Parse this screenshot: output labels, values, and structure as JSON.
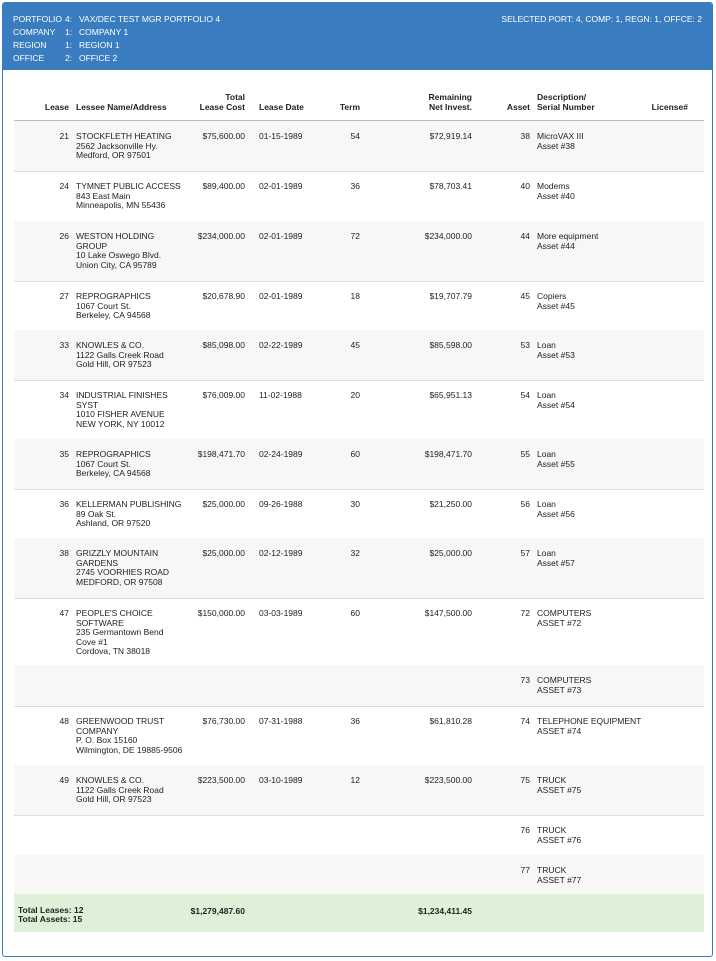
{
  "header": {
    "rows": [
      {
        "key": "PORTFOLIO",
        "num": "4:",
        "value": "VAX/DEC TEST MGR PORTFOLIO 4"
      },
      {
        "key": "COMPANY",
        "num": "1:",
        "value": "COMPANY 1"
      },
      {
        "key": "REGION",
        "num": "1:",
        "value": "REGION 1"
      },
      {
        "key": "OFFICE",
        "num": "2:",
        "value": "OFFICE 2"
      }
    ],
    "selected": "SELECTED PORT: 4, COMP: 1, REGN: 1, OFFCE: 2"
  },
  "columns": {
    "lease": "Lease",
    "name": "Lessee Name/Address",
    "cost_1": "Total",
    "cost_2": "Lease Cost",
    "date": "Lease Date",
    "term": "Term",
    "net_1": "Remaining",
    "net_2": "Net Invest.",
    "asset": "Asset",
    "desc_1": "Description/",
    "desc_2": "Serial Number",
    "license": "License#"
  },
  "rows": [
    {
      "lease": "21",
      "name": [
        "STOCKFLETH HEATING",
        "2562 Jacksonville Hy.",
        "Medford,  OR 97501"
      ],
      "cost": "$75,600.00",
      "date": "01-15-1989",
      "term": "54",
      "net": "$72,919.14",
      "asset": "38",
      "desc": [
        "MicroVAX III",
        "Asset #38"
      ]
    },
    {
      "lease": "24",
      "name": [
        "TYMNET PUBLIC ACCESS",
        "843 East Main",
        "Minneapolis,  MN 55436"
      ],
      "cost": "$89,400.00",
      "date": "02-01-1989",
      "term": "36",
      "net": "$78,703.41",
      "asset": "40",
      "desc": [
        "Modems",
        "Asset #40"
      ]
    },
    {
      "lease": "26",
      "name": [
        "WESTON HOLDING",
        "GROUP",
        "10 Lake Oswego Blvd.",
        "Union City,  CA 95789"
      ],
      "cost": "$234,000.00",
      "date": "02-01-1989",
      "term": "72",
      "net": "$234,000.00",
      "asset": "44",
      "desc": [
        "More equipment",
        "Asset #44"
      ]
    },
    {
      "lease": "27",
      "name": [
        "REPROGRAPHICS",
        "1067 Court St.",
        "Berkeley,  CA 94568"
      ],
      "cost": "$20,678.90",
      "date": "02-01-1989",
      "term": "18",
      "net": "$19,707.79",
      "asset": "45",
      "desc": [
        "Copiers",
        "Asset #45"
      ]
    },
    {
      "lease": "33",
      "name": [
        "KNOWLES & CO.",
        "1122 Galls Creek Road",
        "Gold Hill,  OR 97523"
      ],
      "cost": "$85,098.00",
      "date": "02-22-1989",
      "term": "45",
      "net": "$85,598.00",
      "asset": "53",
      "desc": [
        "Loan",
        "Asset #53"
      ]
    },
    {
      "lease": "34",
      "name": [
        "INDUSTRIAL FINISHES",
        "SYST",
        "1010 FISHER AVENUE",
        "NEW YORK,  NY 10012"
      ],
      "cost": "$76,009.00",
      "date": "11-02-1988",
      "term": "20",
      "net": "$65,951.13",
      "asset": "54",
      "desc": [
        "Loan",
        "Asset #54"
      ]
    },
    {
      "lease": "35",
      "name": [
        "REPROGRAPHICS",
        "1067 Court St.",
        "Berkeley,  CA 94568"
      ],
      "cost": "$198,471.70",
      "date": "02-24-1989",
      "term": "60",
      "net": "$198,471.70",
      "asset": "55",
      "desc": [
        "Loan",
        "Asset #55"
      ]
    },
    {
      "lease": "36",
      "name": [
        "KELLERMAN PUBLISHING",
        "89 Oak St.",
        "Ashland,  OR 97520"
      ],
      "cost": "$25,000.00",
      "date": "09-26-1988",
      "term": "30",
      "net": "$21,250.00",
      "asset": "56",
      "desc": [
        "Loan",
        "Asset #56"
      ]
    },
    {
      "lease": "38",
      "name": [
        "GRIZZLY MOUNTAIN",
        "GARDENS",
        "2745 VOORHIES ROAD",
        "MEDFORD,  OR 97508"
      ],
      "cost": "$25,000.00",
      "date": "02-12-1989",
      "term": "32",
      "net": "$25,000.00",
      "asset": "57",
      "desc": [
        "Loan",
        "Asset #57"
      ]
    },
    {
      "lease": "47",
      "name": [
        "PEOPLE'S CHOICE",
        "SOFTWARE",
        "235 Germantown Bend",
        "Cove #1",
        "Cordova,  TN 38018"
      ],
      "cost": "$150,000.00",
      "date": "03-03-1989",
      "term": "60",
      "net": "$147,500.00",
      "asset": "72",
      "desc": [
        "COMPUTERS",
        "ASSET #72"
      ]
    },
    {
      "lease": "",
      "name": [],
      "cost": "",
      "date": "",
      "term": "",
      "net": "",
      "asset": "73",
      "desc": [
        "COMPUTERS",
        "ASSET #73"
      ]
    },
    {
      "lease": "48",
      "name": [
        "GREENWOOD TRUST",
        "COMPANY",
        "P. O. Box 15160",
        "Wilmington,  DE 19885-9506"
      ],
      "cost": "$76,730.00",
      "date": "07-31-1988",
      "term": "36",
      "net": "$61,810.28",
      "asset": "74",
      "desc": [
        "TELEPHONE EQUIPMENT",
        "ASSET #74"
      ]
    },
    {
      "lease": "49",
      "name": [
        "KNOWLES & CO.",
        "1122 Galls Creek Road",
        "Gold Hill,  OR 97523"
      ],
      "cost": "$223,500.00",
      "date": "03-10-1989",
      "term": "12",
      "net": "$223,500.00",
      "asset": "75",
      "desc": [
        "TRUCK",
        "ASSET #75"
      ]
    },
    {
      "lease": "",
      "name": [],
      "cost": "",
      "date": "",
      "term": "",
      "net": "",
      "asset": "76",
      "desc": [
        "TRUCK",
        "ASSET #76"
      ]
    },
    {
      "lease": "",
      "name": [],
      "cost": "",
      "date": "",
      "term": "",
      "net": "",
      "asset": "77",
      "desc": [
        "TRUCK",
        "ASSET #77"
      ]
    }
  ],
  "totals": {
    "leases": "Total Leases: 12",
    "assets": "Total Assets: 15",
    "cost": "$1,279,487.60",
    "net": "$1,234,411.45"
  }
}
